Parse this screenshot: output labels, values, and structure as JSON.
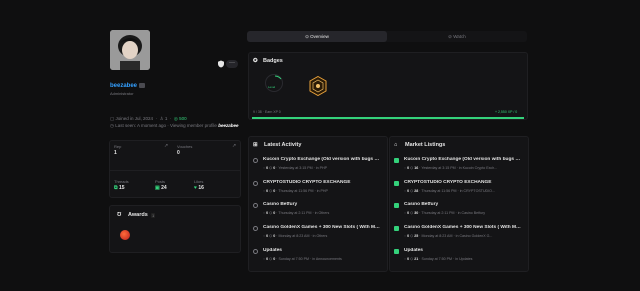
{
  "profile": {
    "username": "beezabee",
    "role": "Administrator",
    "joined": "Joined in Jul, 2024",
    "reputation": "1",
    "xp": "500",
    "last_seen": "Last seen: A moment ago · Viewing member profile",
    "last_seen_user": "beezabee"
  },
  "tabs": [
    {
      "label": "Overview",
      "active": true
    },
    {
      "label": "Watch",
      "active": false
    }
  ],
  "badges": {
    "title": "Badges",
    "level_label": "Level",
    "progress_left": "9 / 38  ·  Earn XP 0",
    "progress_right": "+ 2,550 XP / 0",
    "progress_fraction": 1.0
  },
  "stats": {
    "rep_label": "Rep",
    "rep_value": "1",
    "vouches_label": "Vouches",
    "vouches_value": "0",
    "threads_label": "Threads",
    "threads_value": "15",
    "posts_label": "Posts",
    "posts_value": "24",
    "likes_label": "Likes",
    "likes_value": "16"
  },
  "awards": {
    "title": "Awards",
    "count": "1"
  },
  "activity": {
    "title": "Latest Activity",
    "items": [
      {
        "title": "Kucoin Crypto Exchange (Old version with bugs an...",
        "a": "0",
        "b": "0",
        "meta": "Yesterday at 3:15 PM",
        "cat": "PHP"
      },
      {
        "title": "CRYPTOSTUDIO CRYPTO EXCHANGE",
        "a": "0",
        "b": "0",
        "meta": "Thursday at 11:56 PM",
        "cat": "PHP"
      },
      {
        "title": "Casino Betfury",
        "a": "0",
        "b": "0",
        "meta": "Thursday at 2:11 PM",
        "cat": "Others"
      },
      {
        "title": "Casino GoldenX Games + 300 New Slots ( With Mo...",
        "a": "0",
        "b": "0",
        "meta": "Monday at 8:23 AM",
        "cat": "Others"
      },
      {
        "title": "Updates",
        "a": "0",
        "b": "0",
        "meta": "Sunday at 7:50 PM",
        "cat": "Announcements"
      }
    ]
  },
  "market": {
    "title": "Market Listings",
    "items": [
      {
        "title": "Kucoin Crypto Exchange (Old version with bugs an...",
        "a": "0",
        "b": "16",
        "meta": "Yesterday at 3:15 PM",
        "cat": "Kucoin Crypto Exch..."
      },
      {
        "title": "CRYPTOSTUDIO CRYPTO EXCHANGE",
        "a": "0",
        "b": "28",
        "meta": "Thursday at 11:56 PM",
        "cat": "CRYPTOSTUDIO..."
      },
      {
        "title": "Casino Betfury",
        "a": "0",
        "b": "30",
        "meta": "Thursday at 2:11 PM",
        "cat": "Casino Betfury"
      },
      {
        "title": "Casino GoldenX Games + 300 New Slots ( With Mo...",
        "a": "0",
        "b": "25",
        "meta": "Monday at 8:23 AM",
        "cat": "Casino GoldenX G..."
      },
      {
        "title": "Updates",
        "a": "0",
        "b": "21",
        "meta": "Sunday at 7:50 PM",
        "cat": "Updates"
      }
    ]
  },
  "colors": {
    "accent": "#34d27b",
    "username": "#34a0ff",
    "background": "#0f0f10",
    "panel": "#141416"
  }
}
